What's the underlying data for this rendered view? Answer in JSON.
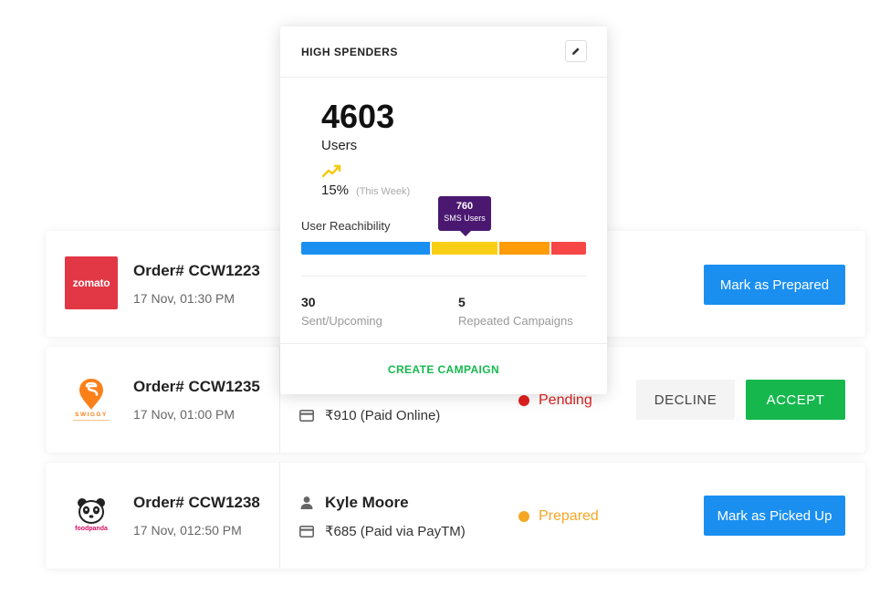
{
  "colors": {
    "primary": "#1a8ff0",
    "accept": "#16b84e",
    "pending": "#e02020",
    "prepared": "#f5a623",
    "tooltip": "#4a1870",
    "zomato": "#e23744",
    "swiggy": "#fc8019",
    "foodpanda": "#d70f64"
  },
  "popover": {
    "title": "HIGH SPENDERS",
    "edit_icon": "pencil-icon",
    "count": "4603",
    "count_label": "Users",
    "trend_icon": "trending-up-icon",
    "trend_pct": "15%",
    "trend_period": "(This Week)",
    "reach_label": "User Reachibility",
    "tooltip": {
      "value": "760",
      "label": "SMS Users"
    },
    "reach_segments": [
      {
        "fraction": 0.46,
        "color": "#1a8ff0"
      },
      {
        "fraction": 0.235,
        "color": "#f9cf16"
      },
      {
        "fraction": 0.18,
        "color": "#ff9c0a"
      },
      {
        "fraction": 0.125,
        "color": "#f74646"
      }
    ],
    "stats": [
      {
        "value": "30",
        "label": "Sent/Upcoming"
      },
      {
        "value": "5",
        "label": "Repeated Campaigns"
      }
    ],
    "cta": "CREATE CAMPAIGN"
  },
  "orders": [
    {
      "platform": "zomato",
      "logo_text": "zomato",
      "order_id": "Order# CCW1223",
      "time": "17 Nov, 01:30 PM",
      "action": "Mark as Prepared"
    },
    {
      "platform": "swiggy",
      "logo_text": "SWIGGY",
      "order_id": "Order# CCW1235",
      "time": "17 Nov, 01:00 PM",
      "payment_icon": "card-icon",
      "payment": "₹910  (Paid Online)",
      "status": "Pending",
      "decline": "DECLINE",
      "accept": "ACCEPT"
    },
    {
      "platform": "foodpanda",
      "logo_text": "foodpanda",
      "order_id": "Order# CCW1238",
      "time": "17 Nov, 012:50 PM",
      "customer_icon": "person-icon",
      "customer": "Kyle Moore",
      "payment_icon": "card-icon",
      "payment": "₹685  (Paid via PayTM)",
      "status": "Prepared",
      "action": "Mark as Picked Up"
    }
  ]
}
